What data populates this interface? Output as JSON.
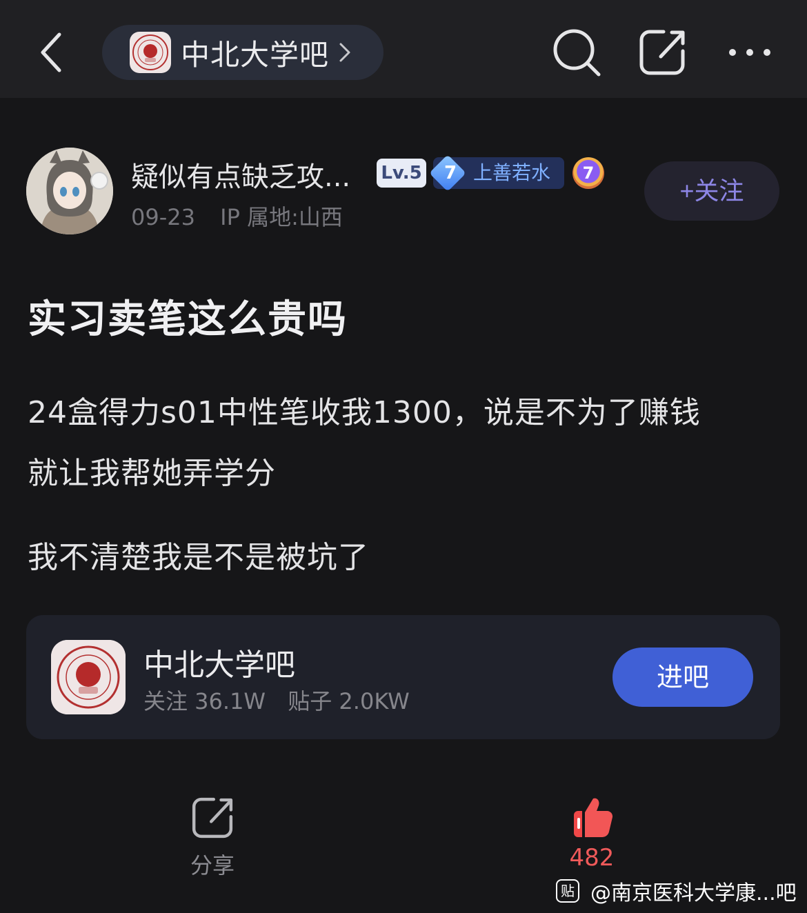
{
  "header": {
    "forum_name": "中北大学吧",
    "icons": {
      "back": "back-chevron-icon",
      "search": "search-icon",
      "share": "share-icon",
      "more": "more-dots-icon"
    }
  },
  "author": {
    "name": "疑似有点缺乏攻...",
    "level": "Lv.5",
    "rank_number": "7",
    "rank_title": "上善若水",
    "medal_number": "7",
    "date": "09-23",
    "ip": "IP 属地:山西",
    "follow_label": "+关注"
  },
  "post": {
    "title": "实习卖笔这么贵吗",
    "paragraph_1_line_1": "24盒得力s01中性笔收我1300，说是不为了赚钱",
    "paragraph_1_line_2": "就让我帮她弄学分",
    "paragraph_2": "我不清楚我是不是被坑了"
  },
  "forum_card": {
    "name": "中北大学吧",
    "followers": "关注 36.1W",
    "posts": "贴子 2.0KW",
    "enter_label": "进吧"
  },
  "actions": {
    "share_label": "分享",
    "like_count": "482"
  },
  "watermark": {
    "logo_text": "贴",
    "text": "@南京医科大学康...吧"
  },
  "colors": {
    "background": "#161618",
    "topbar": "#202023",
    "accent_blue": "#4060d6",
    "follow_text": "#8d86e6",
    "like_red": "#f05a5a"
  }
}
